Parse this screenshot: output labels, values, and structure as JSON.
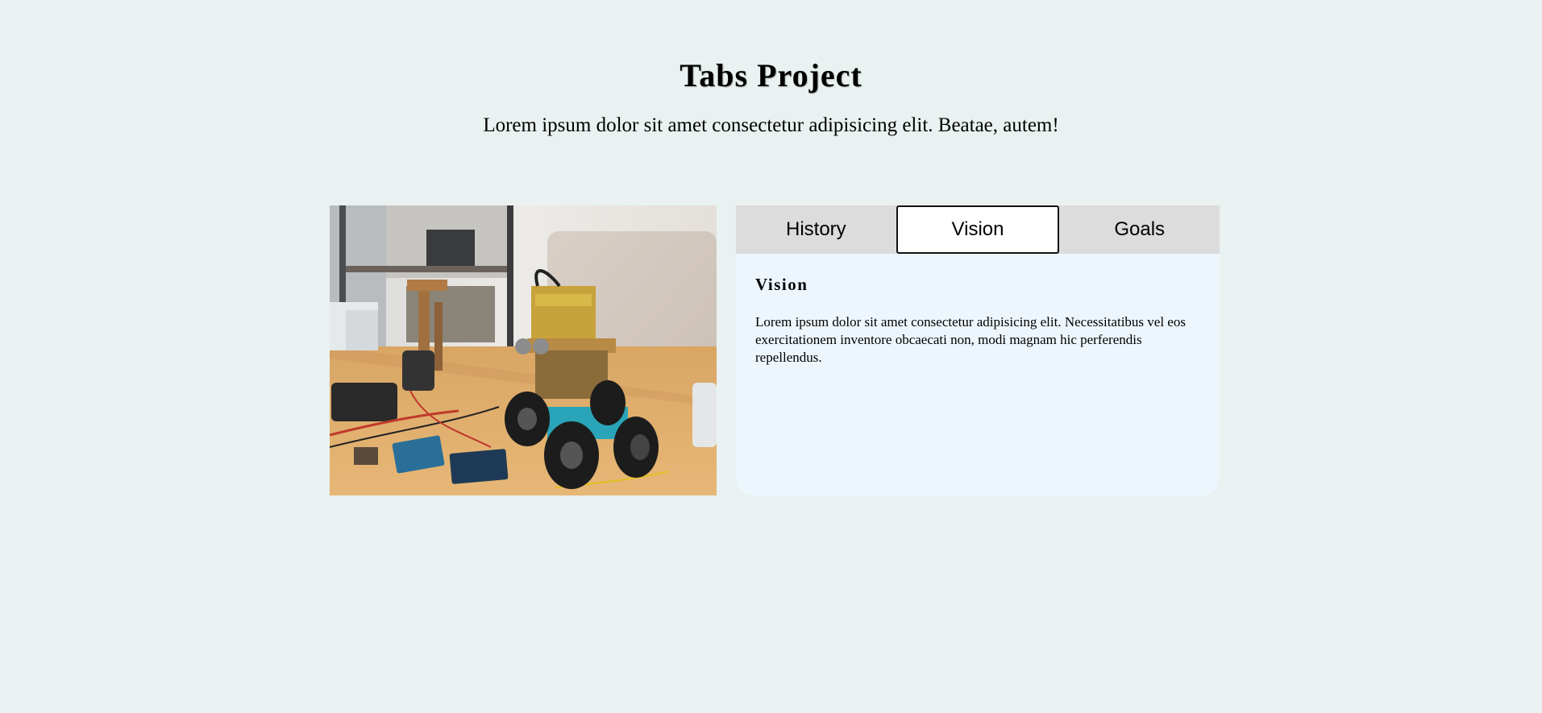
{
  "header": {
    "title": "Tabs Project",
    "subtitle": "Lorem ipsum dolor sit amet consectetur adipisicing elit. Beatae, autem!"
  },
  "tabs": [
    {
      "label": "History",
      "active": false
    },
    {
      "label": "Vision",
      "active": true
    },
    {
      "label": "Goals",
      "active": false
    }
  ],
  "content": {
    "heading": "Vision",
    "text": "Lorem ipsum dolor sit amet consectetur adipisicing elit. Necessitatibus vel eos exercitationem inventore obcaecati non, modi magnam hic perferendis repellendus."
  },
  "colors": {
    "background": "#e9f2f1",
    "panel": "#eef6fd",
    "tab_bar": "#dcdcdc",
    "active_tab": "#ffffff"
  },
  "image": {
    "subject": "robot-car-on-desk"
  }
}
